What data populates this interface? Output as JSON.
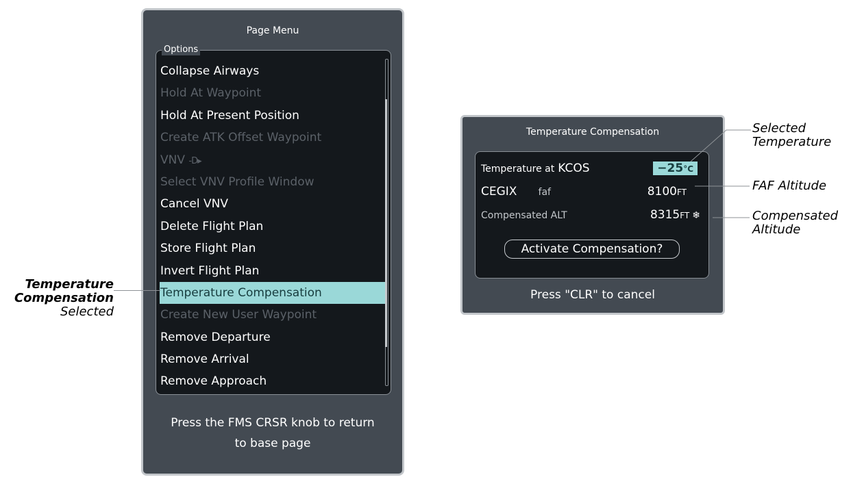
{
  "page_menu": {
    "title": "Page Menu",
    "options_label": "Options",
    "items": [
      {
        "label": "Collapse Airways",
        "state": "enabled"
      },
      {
        "label": "Hold At Waypoint",
        "state": "disabled"
      },
      {
        "label": "Hold At Present Position",
        "state": "enabled"
      },
      {
        "label": "Create ATK Offset Waypoint",
        "state": "disabled"
      },
      {
        "label": "VNV",
        "suffix": "-D▸",
        "state": "disabled"
      },
      {
        "label": "Select VNV Profile Window",
        "state": "disabled"
      },
      {
        "label": "Cancel VNV",
        "state": "enabled"
      },
      {
        "label": "Delete Flight Plan",
        "state": "enabled"
      },
      {
        "label": "Store Flight Plan",
        "state": "enabled"
      },
      {
        "label": "Invert Flight Plan",
        "state": "enabled"
      },
      {
        "label": "Temperature Compensation",
        "state": "selected"
      },
      {
        "label": "Create New User Waypoint",
        "state": "disabled"
      },
      {
        "label": "Remove Departure",
        "state": "enabled"
      },
      {
        "label": "Remove Arrival",
        "state": "enabled"
      },
      {
        "label": "Remove Approach",
        "state": "enabled"
      }
    ],
    "footer_line1": "Press the FMS CRSR knob to return",
    "footer_line2": "to base page"
  },
  "temp_comp": {
    "title": "Temperature Compensation",
    "temp_label": "Temperature at",
    "airport": "KCOS",
    "temperature": "−25",
    "temp_unit": "°C",
    "fix_name": "CEGIX",
    "fix_type": "faf",
    "faf_altitude": "8100",
    "comp_label": "Compensated ALT",
    "comp_altitude": "8315",
    "alt_unit": "FT",
    "activate_label": "Activate Compensation?",
    "footer": "Press \"CLR\" to cancel",
    "icon": "snowflake-icon"
  },
  "callouts": {
    "temp_comp_line1": "Temperature",
    "temp_comp_line2": "Compensation",
    "temp_comp_line3": "Selected",
    "selected_temp_line1": "Selected",
    "selected_temp_line2": "Temperature",
    "faf_alt": "FAF Altitude",
    "comp_alt_line1": "Compensated",
    "comp_alt_line2": "Altitude"
  },
  "colors": {
    "panel_bg": "#434a52",
    "inner_bg": "#14181c",
    "highlight": "#9ad8d8",
    "disabled_text": "#5b6168"
  }
}
